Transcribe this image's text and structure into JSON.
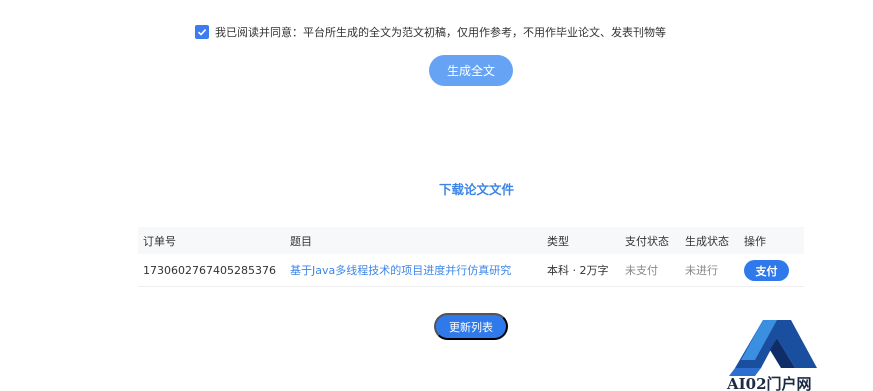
{
  "agreement": {
    "checked": true,
    "text": "我已阅读并同意：平台所生成的全文为范文初稿，仅用作参考，不用作毕业论文、发表刊物等"
  },
  "generate_button": "生成全文",
  "download_section": {
    "title": "下载论文文件",
    "columns": [
      "订单号",
      "题目",
      "类型",
      "支付状态",
      "生成状态",
      "操作"
    ],
    "rows": [
      {
        "order_no": "1730602767405285376",
        "title": "基于Java多线程技术的项目进度并行仿真研究",
        "type": "本科 · 2万字",
        "pay_status": "未支付",
        "gen_status": "未进行",
        "action": "支付"
      }
    ]
  },
  "refresh_button": "更新列表",
  "watermark": {
    "text": "AI02门户网"
  },
  "colors": {
    "accent": "#2f79ea",
    "accent_light": "#66a3f5",
    "link": "#3d86e8"
  }
}
